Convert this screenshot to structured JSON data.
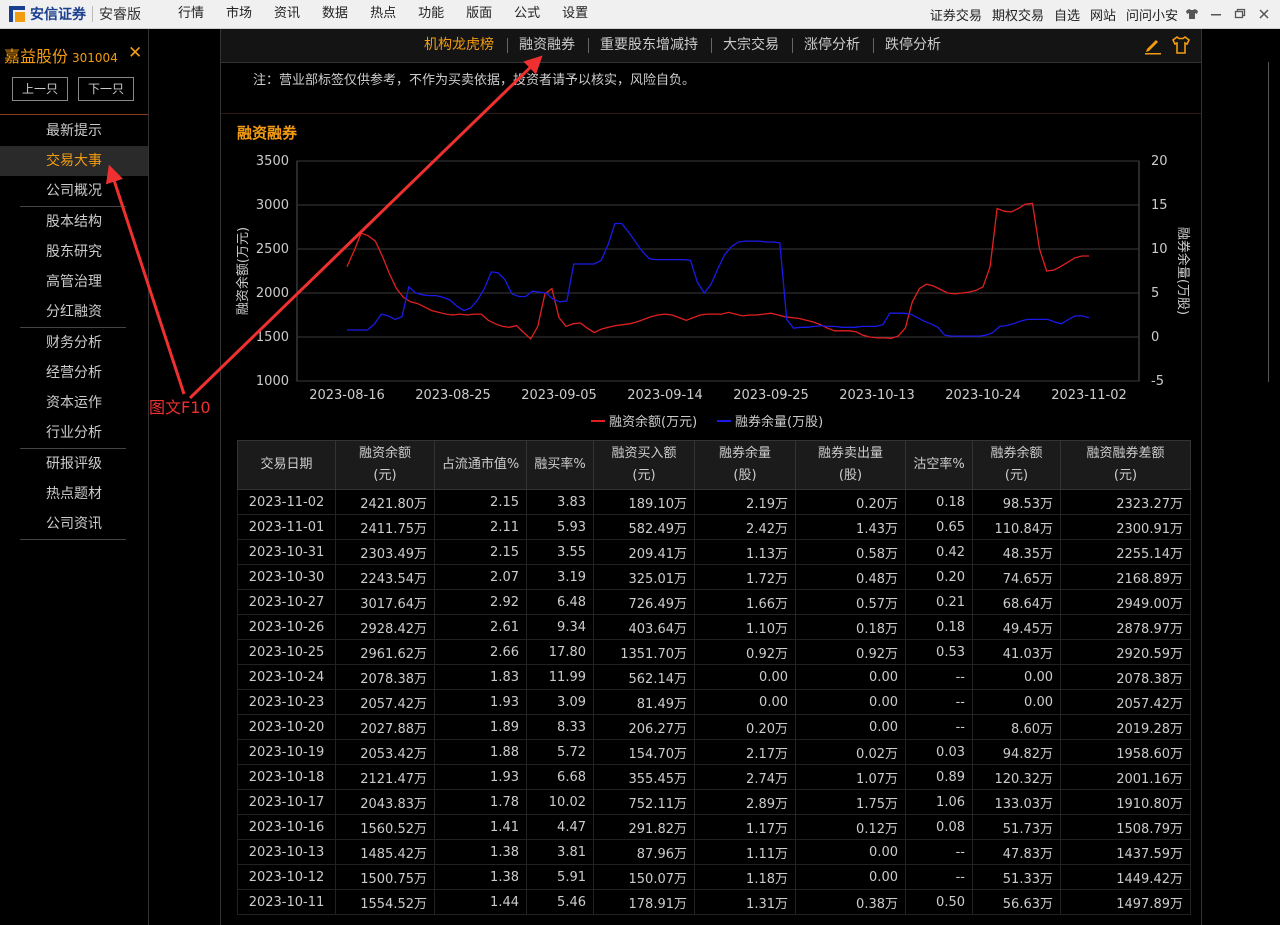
{
  "app": {
    "logo_name": "安信证券",
    "edition": "安睿版",
    "menu": [
      "行情",
      "市场",
      "资讯",
      "数据",
      "热点",
      "功能",
      "版面",
      "公式",
      "设置"
    ],
    "top_links": [
      "证券交易",
      "期权交易",
      "自选",
      "网站",
      "问问小安"
    ],
    "window_icons": [
      "shirt-icon",
      "minimize-icon",
      "restore-icon",
      "close-icon"
    ],
    "colors": {
      "accent": "#f39c12",
      "margin_line": "#e02020",
      "short_line": "#1a1ae6",
      "annotation": "#ee3030"
    }
  },
  "stock": {
    "name": "嘉益股份",
    "code": "301004",
    "close_glyph": "✕",
    "prev": "上一只",
    "next": "下一只"
  },
  "sidebar": {
    "groups": [
      [
        "最新提示",
        "交易大事",
        "公司概况"
      ],
      [
        "股本结构",
        "股东研究",
        "高管治理",
        "分红融资"
      ],
      [
        "财务分析",
        "经营分析",
        "资本运作",
        "行业分析"
      ],
      [
        "研报评级",
        "热点题材",
        "公司资讯"
      ]
    ],
    "active": "交易大事"
  },
  "tabs": {
    "items": [
      "机构龙虎榜",
      "融资融券",
      "重要股东增减持",
      "大宗交易",
      "涨停分析",
      "跌停分析"
    ],
    "active": "机构龙虎榜"
  },
  "note": "注：营业部标签仅供参考，不作为买卖依据，投资者请予以核实，风险自负。",
  "section_title": "融资融券",
  "annotation_label": "图文F10",
  "chart_data": {
    "type": "line",
    "x_ticks": [
      "2023-08-16",
      "2023-08-25",
      "2023-09-05",
      "2023-09-14",
      "2023-09-25",
      "2023-10-13",
      "2023-10-24",
      "2023-11-02"
    ],
    "ylabel": "融资余额(万元)",
    "ylabel_right": "融券余量(万股)",
    "ylim": [
      1000,
      3500
    ],
    "y_ticks": [
      1000,
      1500,
      2000,
      2500,
      3000,
      3500
    ],
    "ylim_right": [
      -5,
      20
    ],
    "y_ticks_right": [
      -5,
      0,
      5,
      10,
      15,
      20
    ],
    "grid": true,
    "legend_position": "bottom",
    "series": [
      {
        "name": "融资余额(万元)",
        "axis": "left",
        "color": "#e02020",
        "values": [
          2300,
          2480,
          2680,
          2650,
          2590,
          2420,
          2220,
          2050,
          1950,
          1900,
          1880,
          1840,
          1800,
          1780,
          1760,
          1750,
          1760,
          1750,
          1760,
          1760,
          1690,
          1650,
          1620,
          1610,
          1630,
          1550,
          1480,
          1620,
          1990,
          2050,
          1720,
          1620,
          1650,
          1660,
          1600,
          1550,
          1590,
          1610,
          1630,
          1640,
          1650,
          1670,
          1700,
          1730,
          1750,
          1760,
          1750,
          1720,
          1690,
          1720,
          1750,
          1760,
          1760,
          1760,
          1780,
          1760,
          1740,
          1750,
          1750,
          1760,
          1770,
          1750,
          1730,
          1720,
          1710,
          1690,
          1670,
          1640,
          1600,
          1570,
          1570,
          1570,
          1560,
          1520,
          1500,
          1490,
          1490,
          1485,
          1510,
          1600,
          1900,
          2050,
          2100,
          2080,
          2040,
          2000,
          1990,
          2000,
          2010,
          2030,
          2070,
          2300,
          2960,
          2930,
          2920,
          2960,
          3010,
          3017,
          2500,
          2250,
          2260,
          2300,
          2350,
          2400,
          2420,
          2420
        ]
      },
      {
        "name": "融券余量(万股)",
        "axis": "right",
        "color": "#1a1ae6",
        "values": [
          0.8,
          0.8,
          0.8,
          0.8,
          1.5,
          2.6,
          2.4,
          2.0,
          2.3,
          5.7,
          5.0,
          4.8,
          4.7,
          4.7,
          4.5,
          4.2,
          3.5,
          3.0,
          3.3,
          4.2,
          5.5,
          7.4,
          7.3,
          6.5,
          4.9,
          4.6,
          4.6,
          5.2,
          5.1,
          5.0,
          4.3,
          4.0,
          4.1,
          8.3,
          8.3,
          8.3,
          8.3,
          8.7,
          10.5,
          12.9,
          12.9,
          11.9,
          10.8,
          9.7,
          8.9,
          8.8,
          8.8,
          8.8,
          8.8,
          8.8,
          8.7,
          6.2,
          5.0,
          6.0,
          7.8,
          9.4,
          10.3,
          10.8,
          10.9,
          10.9,
          10.9,
          10.8,
          10.8,
          10.7,
          2.0,
          1.0,
          1.1,
          1.1,
          1.2,
          1.3,
          1.2,
          1.2,
          1.1,
          1.1,
          1.1,
          1.2,
          1.2,
          1.2,
          1.4,
          2.7,
          2.7,
          2.7,
          2.6,
          2.2,
          1.8,
          1.5,
          1.1,
          0.2,
          0.1,
          0.1,
          0.1,
          0.1,
          0.1,
          0.2,
          0.5,
          1.2,
          1.3,
          1.5,
          1.8,
          2.0,
          2.0,
          2.0,
          2.0,
          1.7,
          1.5,
          2.0,
          2.4,
          2.4,
          2.2
        ]
      }
    ]
  },
  "table": {
    "headers": [
      [
        "交易日期"
      ],
      [
        "融资余额",
        "(元)"
      ],
      [
        "占流通市值%"
      ],
      [
        "融买率%"
      ],
      [
        "融资买入额",
        "(元)"
      ],
      [
        "融券余量",
        "(股)"
      ],
      [
        "融券卖出量",
        "(股)"
      ],
      [
        "沽空率%"
      ],
      [
        "融券余额",
        "(元)"
      ],
      [
        "融资融券差额",
        "(元)"
      ]
    ],
    "rows": [
      [
        "2023-11-02",
        "2421.80万",
        "2.15",
        "3.83",
        "189.10万",
        "2.19万",
        "0.20万",
        "0.18",
        "98.53万",
        "2323.27万"
      ],
      [
        "2023-11-01",
        "2411.75万",
        "2.11",
        "5.93",
        "582.49万",
        "2.42万",
        "1.43万",
        "0.65",
        "110.84万",
        "2300.91万"
      ],
      [
        "2023-10-31",
        "2303.49万",
        "2.15",
        "3.55",
        "209.41万",
        "1.13万",
        "0.58万",
        "0.42",
        "48.35万",
        "2255.14万"
      ],
      [
        "2023-10-30",
        "2243.54万",
        "2.07",
        "3.19",
        "325.01万",
        "1.72万",
        "0.48万",
        "0.20",
        "74.65万",
        "2168.89万"
      ],
      [
        "2023-10-27",
        "3017.64万",
        "2.92",
        "6.48",
        "726.49万",
        "1.66万",
        "0.57万",
        "0.21",
        "68.64万",
        "2949.00万"
      ],
      [
        "2023-10-26",
        "2928.42万",
        "2.61",
        "9.34",
        "403.64万",
        "1.10万",
        "0.18万",
        "0.18",
        "49.45万",
        "2878.97万"
      ],
      [
        "2023-10-25",
        "2961.62万",
        "2.66",
        "17.80",
        "1351.70万",
        "0.92万",
        "0.92万",
        "0.53",
        "41.03万",
        "2920.59万"
      ],
      [
        "2023-10-24",
        "2078.38万",
        "1.83",
        "11.99",
        "562.14万",
        "0.00",
        "0.00",
        "--",
        "0.00",
        "2078.38万"
      ],
      [
        "2023-10-23",
        "2057.42万",
        "1.93",
        "3.09",
        "81.49万",
        "0.00",
        "0.00",
        "--",
        "0.00",
        "2057.42万"
      ],
      [
        "2023-10-20",
        "2027.88万",
        "1.89",
        "8.33",
        "206.27万",
        "0.20万",
        "0.00",
        "--",
        "8.60万",
        "2019.28万"
      ],
      [
        "2023-10-19",
        "2053.42万",
        "1.88",
        "5.72",
        "154.70万",
        "2.17万",
        "0.02万",
        "0.03",
        "94.82万",
        "1958.60万"
      ],
      [
        "2023-10-18",
        "2121.47万",
        "1.93",
        "6.68",
        "355.45万",
        "2.74万",
        "1.07万",
        "0.89",
        "120.32万",
        "2001.16万"
      ],
      [
        "2023-10-17",
        "2043.83万",
        "1.78",
        "10.02",
        "752.11万",
        "2.89万",
        "1.75万",
        "1.06",
        "133.03万",
        "1910.80万"
      ],
      [
        "2023-10-16",
        "1560.52万",
        "1.41",
        "4.47",
        "291.82万",
        "1.17万",
        "0.12万",
        "0.08",
        "51.73万",
        "1508.79万"
      ],
      [
        "2023-10-13",
        "1485.42万",
        "1.38",
        "3.81",
        "87.96万",
        "1.11万",
        "0.00",
        "--",
        "47.83万",
        "1437.59万"
      ],
      [
        "2023-10-12",
        "1500.75万",
        "1.38",
        "5.91",
        "150.07万",
        "1.18万",
        "0.00",
        "--",
        "51.33万",
        "1449.42万"
      ],
      [
        "2023-10-11",
        "1554.52万",
        "1.44",
        "5.46",
        "178.91万",
        "1.31万",
        "0.38万",
        "0.50",
        "56.63万",
        "1497.89万"
      ]
    ]
  }
}
